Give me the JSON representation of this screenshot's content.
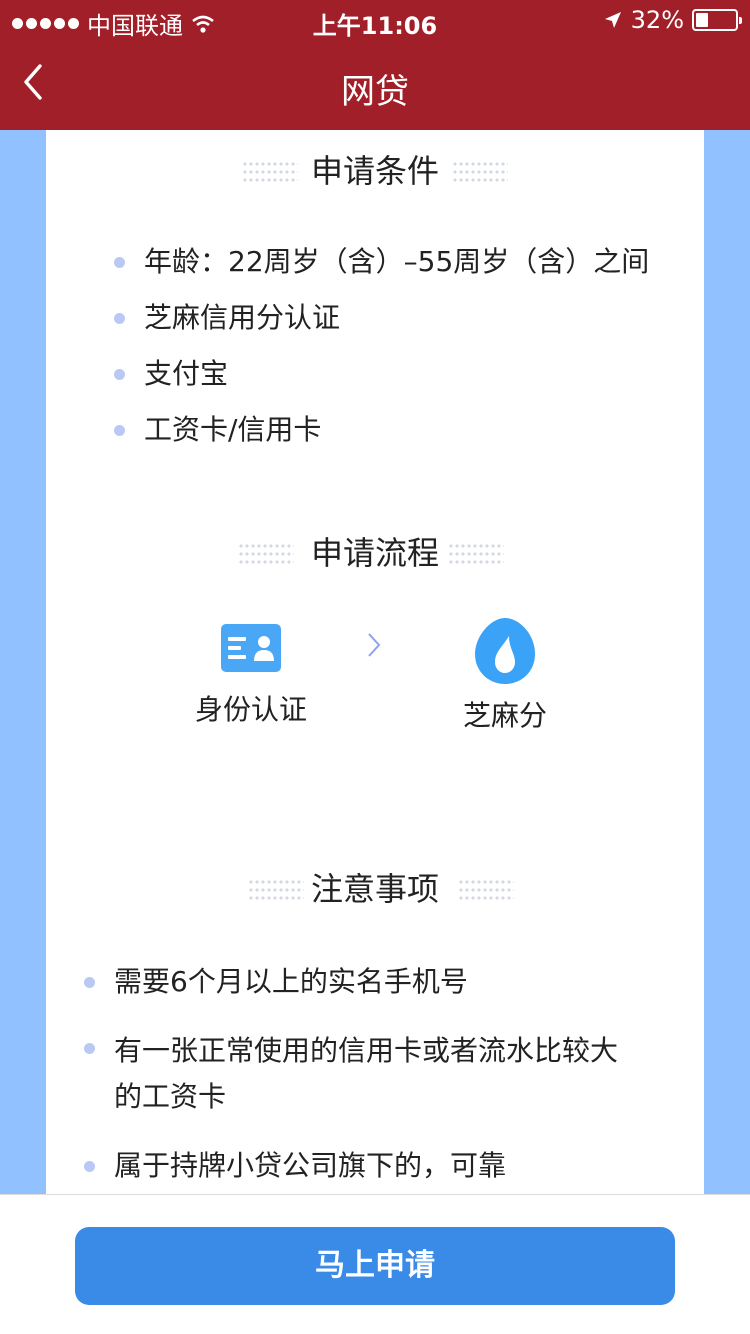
{
  "status_bar": {
    "carrier": "中国联通",
    "time": "上午11:06",
    "battery": "32%",
    "battery_level": 0.32
  },
  "nav": {
    "title": "网贷",
    "back_icon": "chevron-left-icon"
  },
  "conditions": {
    "title": "申请条件",
    "items": [
      "年龄：22周岁（含）–55周岁（含）之间",
      "芝麻信用分认证",
      "支付宝",
      "工资卡/信用卡"
    ]
  },
  "process": {
    "title": "申请流程",
    "steps": [
      {
        "label": "身份认证",
        "icon": "id-card-icon"
      },
      {
        "label": "芝麻分",
        "icon": "sesame-drop-icon"
      }
    ]
  },
  "notes": {
    "title": "注意事项",
    "items": [
      "需要6个月以上的实名手机号",
      "有一张正常使用的信用卡或者流水比较大的工资卡",
      "属于持牌小贷公司旗下的，可靠"
    ]
  },
  "footer": {
    "apply_label": "马上申请"
  },
  "colors": {
    "header": "#a11f28",
    "side_background": "#92c1ff",
    "primary_button": "#3a8ae8",
    "bullet": "#b9c9f4"
  }
}
